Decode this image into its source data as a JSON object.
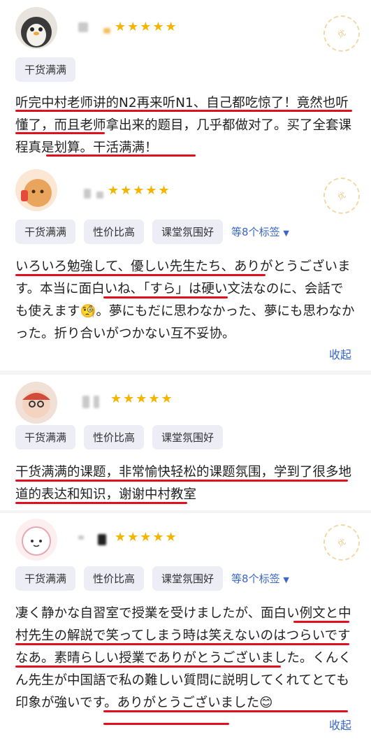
{
  "reviews": [
    {
      "stars": "★★★★★",
      "badge": "优",
      "tags": [
        "干货满满"
      ],
      "text": "听完中村老师讲的N2再来听N1、自己都吃惊了！竟然也听懂了，而且老师拿出来的题目，几乎都做对了。买了全套课程真是划算。干活满满！"
    },
    {
      "stars": "★★★★★",
      "badge": "优",
      "tags": [
        "干货满满",
        "性价比高",
        "课堂氛围好"
      ],
      "more_tags": "等8个标签",
      "text": "いろいろ勉強して、優しい先生たち、ありがとうございます。本当に面白いね、「すら」は硬い文法なのに、会話でも使えます🧐。夢にもだに思わなかった、夢にも思わなかった。折り合いがつかない互不妥协。",
      "collapse": "收起"
    },
    {
      "stars": "★★★★★",
      "tags": [
        "干货满满",
        "性价比高",
        "课堂氛围好"
      ],
      "text": "干货满满的课题，非常愉快轻松的课题氛围，学到了很多地道的表达和知识，谢谢中村教室"
    },
    {
      "stars": "★★★★★",
      "badge": "优",
      "tags": [
        "干货满满",
        "性价比高",
        "课堂氛围好"
      ],
      "more_tags": "等8个标签",
      "text": "凄く静かな自習室で授業を受けましたが、面白い例文と中村先生の解説で笑ってしまう時は笑えないのはつらいですなあ。素晴らしい授業でありがとうございました。くんくん先生が中国語で私の難しい質問に説明してくれてとても印象が強いです。ありがとうございました😊",
      "collapse": "收起"
    }
  ],
  "colors": {
    "star": "#f5b400",
    "underline": "#e0101e",
    "link": "#3966c8"
  }
}
